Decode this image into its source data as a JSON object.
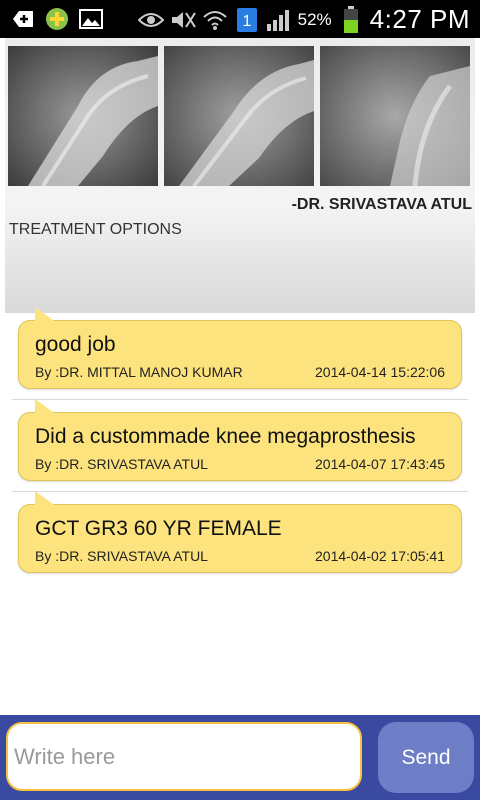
{
  "status_bar": {
    "battery_percent": "52%",
    "time": "4:27 PM",
    "sim_badge": "1",
    "icons": [
      "add-icon",
      "badge-icon",
      "gallery-icon",
      "eye-icon",
      "muted-icon",
      "wifi-icon",
      "sim-icon",
      "signal-icon",
      "battery-icon"
    ]
  },
  "case": {
    "images": [
      "xray-image-1",
      "xray-image-2",
      "xray-image-3"
    ],
    "author": "-DR. SRIVASTAVA ATUL",
    "treatment_label": "TREATMENT OPTIONS"
  },
  "comments": [
    {
      "text": "good job",
      "by": "By :DR. MITTAL MANOJ KUMAR",
      "timestamp": "2014-04-14 15:22:06"
    },
    {
      "text": "Did a custommade knee megaprosthesis",
      "by": "By :DR. SRIVASTAVA ATUL",
      "timestamp": "2014-04-07 17:43:45"
    },
    {
      "text": "GCT GR3 60 YR FEMALE",
      "by": "By :DR. SRIVASTAVA ATUL",
      "timestamp": "2014-04-02 17:05:41"
    }
  ],
  "composer": {
    "placeholder": "Write here",
    "send_label": "Send"
  },
  "colors": {
    "bubble": "#fde37e",
    "input_bar": "#3b4aa1",
    "send_button": "#6e7ec6",
    "input_border": "#f5c242"
  }
}
